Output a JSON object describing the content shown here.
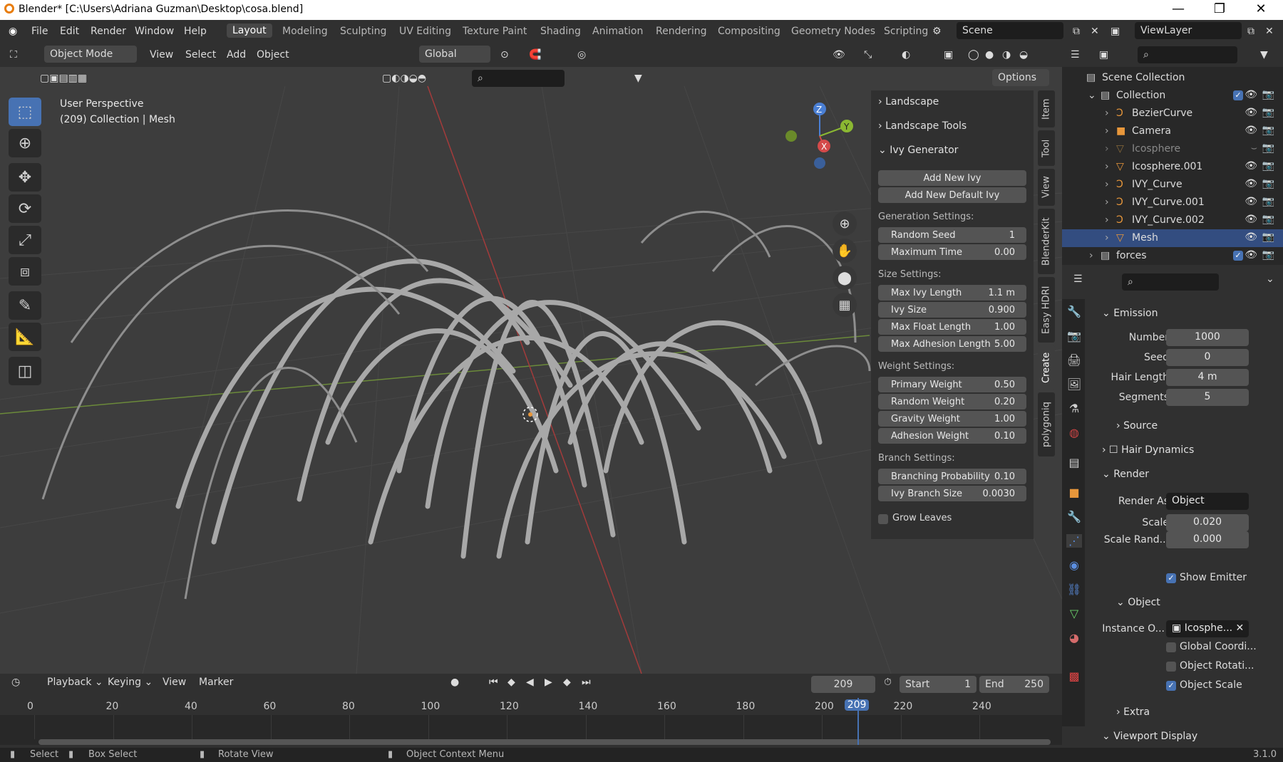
{
  "window": {
    "title": "Blender* [C:\\Users\\Adriana Guzman\\Desktop\\cosa.blend]"
  },
  "menu": [
    "File",
    "Edit",
    "Render",
    "Window",
    "Help"
  ],
  "workspaces": [
    "Layout",
    "Modeling",
    "Sculpting",
    "UV Editing",
    "Texture Paint",
    "Shading",
    "Animation",
    "Rendering",
    "Compositing",
    "Geometry Nodes",
    "Scripting"
  ],
  "scene": "Scene",
  "viewlayer": "ViewLayer",
  "viewport": {
    "mode": "Object Mode",
    "menus": [
      "View",
      "Select",
      "Add",
      "Object"
    ],
    "orientation": "Global",
    "options": "Options",
    "perspective": "User Perspective",
    "info": "(209) Collection | Mesh"
  },
  "npanel": {
    "landscape": "Landscape",
    "landscape_tools": "Landscape Tools",
    "ivy_generator": "Ivy Generator",
    "add_new_ivy": "Add New Ivy",
    "add_new_default_ivy": "Add New Default Ivy",
    "generation": "Generation Settings:",
    "random_seed": {
      "label": "Random Seed",
      "value": "1"
    },
    "max_time": {
      "label": "Maximum Time",
      "value": "0.00"
    },
    "size": "Size Settings:",
    "max_ivy_length": {
      "label": "Max Ivy Length",
      "value": "1.1 m"
    },
    "ivy_size": {
      "label": "Ivy Size",
      "value": "0.900"
    },
    "max_float": {
      "label": "Max Float Length",
      "value": "1.00"
    },
    "max_adhesion": {
      "label": "Max Adhesion Length",
      "value": "5.00"
    },
    "weight": "Weight Settings:",
    "primary": {
      "label": "Primary Weight",
      "value": "0.50"
    },
    "random": {
      "label": "Random Weight",
      "value": "0.20"
    },
    "gravity": {
      "label": "Gravity Weight",
      "value": "1.00"
    },
    "adhesion": {
      "label": "Adhesion Weight",
      "value": "0.10"
    },
    "branch": "Branch Settings:",
    "branching": {
      "label": "Branching Probability",
      "value": "0.10"
    },
    "branch_size": {
      "label": "Ivy Branch Size",
      "value": "0.0030"
    },
    "grow_leaves": "Grow Leaves"
  },
  "vtabs": [
    "Item",
    "Tool",
    "View",
    "BlenderKit",
    "Easy HDRI",
    "Create",
    "polygoniq"
  ],
  "outliner": {
    "scene_collection": "Scene Collection",
    "items": [
      "Collection",
      "BezierCurve",
      "Camera",
      "Icosphere",
      "Icosphere.001",
      "IVY_Curve",
      "IVY_Curve.001",
      "IVY_Curve.002",
      "Mesh",
      "forces"
    ]
  },
  "props": {
    "emission": "Emission",
    "number": {
      "label": "Number",
      "value": "1000"
    },
    "seed": {
      "label": "Seed",
      "value": "0"
    },
    "hair_length": {
      "label": "Hair Length",
      "value": "4 m"
    },
    "segments": {
      "label": "Segments",
      "value": "5"
    },
    "source": "Source",
    "hair_dynamics": "Hair Dynamics",
    "render": "Render",
    "render_as": {
      "label": "Render As",
      "value": "Object"
    },
    "scale": {
      "label": "Scale",
      "value": "0.020"
    },
    "scale_rand": {
      "label": "Scale Rand...",
      "value": "0.000"
    },
    "show_emitter": "Show Emitter",
    "object": "Object",
    "instance": {
      "label": "Instance O...",
      "value": "Icosphe..."
    },
    "global_coord": "Global Coordi...",
    "object_rot": "Object Rotati...",
    "object_scale": "Object Scale",
    "extra": "Extra",
    "viewport_display": "Viewport Display",
    "version": "3.1.0"
  },
  "timeline": {
    "playback": "Playback",
    "keying": "Keying",
    "view": "View",
    "marker": "Marker",
    "current": "209",
    "start_label": "Start",
    "start": "1",
    "end_label": "End",
    "end": "250",
    "ticks": [
      "0",
      "20",
      "40",
      "60",
      "80",
      "100",
      "120",
      "140",
      "160",
      "180",
      "200",
      "220",
      "240"
    ],
    "current_frame": 209
  },
  "status": {
    "select": "Select",
    "box_select": "Box Select",
    "rotate": "Rotate View",
    "context": "Object Context Menu"
  }
}
